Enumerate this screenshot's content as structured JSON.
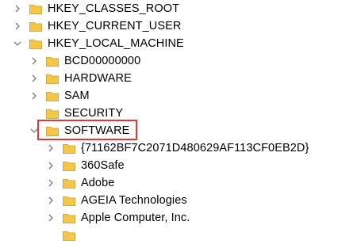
{
  "tree": {
    "nodes": [
      {
        "label": "HKEY_CLASSES_ROOT",
        "expanded": false,
        "icon": "folder-icon"
      },
      {
        "label": "HKEY_CURRENT_USER",
        "expanded": false,
        "icon": "folder-icon"
      },
      {
        "label": "HKEY_LOCAL_MACHINE",
        "expanded": true,
        "icon": "folder-icon"
      },
      {
        "label": "BCD00000000",
        "expanded": false,
        "icon": "folder-icon"
      },
      {
        "label": "HARDWARE",
        "expanded": false,
        "icon": "folder-icon"
      },
      {
        "label": "SAM",
        "expanded": false,
        "icon": "folder-icon"
      },
      {
        "label": "SECURITY",
        "expanded": false,
        "icon": "folder-icon"
      },
      {
        "label": "SOFTWARE",
        "expanded": true,
        "icon": "folder-icon",
        "highlighted": true
      },
      {
        "label": "{71162BF7C2071D480629AF113CF0EB2D}",
        "expanded": false,
        "icon": "folder-icon"
      },
      {
        "label": "360Safe",
        "expanded": false,
        "icon": "folder-icon"
      },
      {
        "label": "Adobe",
        "expanded": false,
        "icon": "folder-icon"
      },
      {
        "label": "AGEIA Technologies",
        "expanded": false,
        "icon": "folder-icon"
      },
      {
        "label": "Apple Computer, Inc.",
        "expanded": false,
        "icon": "folder-icon"
      }
    ]
  },
  "colors": {
    "folder": "#f1c74c",
    "folder_dark": "#d9a935",
    "chevron": "#7a7a7a",
    "highlight_border": "#d93a3a"
  }
}
